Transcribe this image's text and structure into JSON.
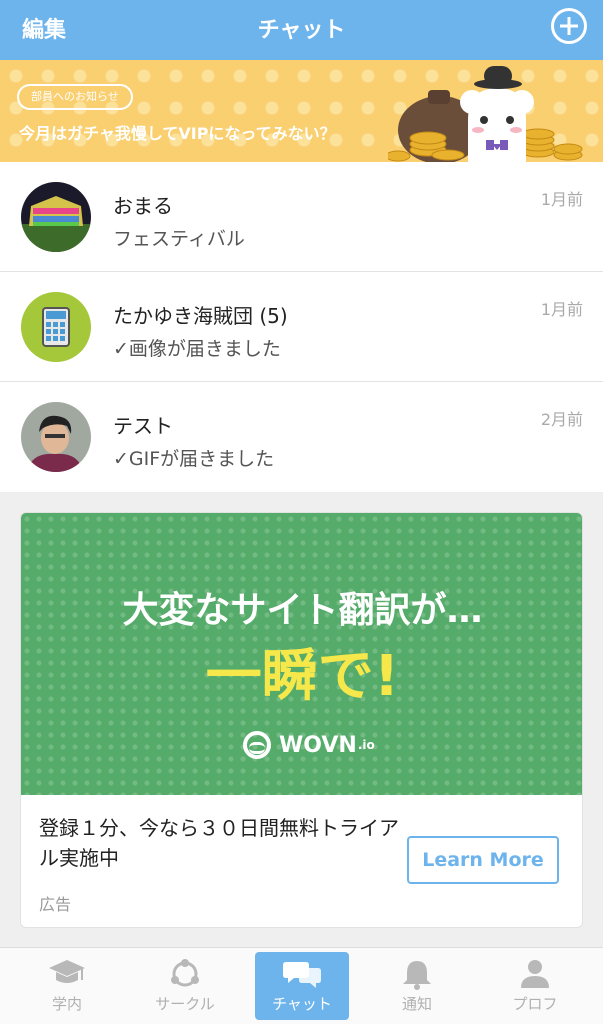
{
  "header": {
    "edit_label": "編集",
    "title": "チャット"
  },
  "banner": {
    "tag": "部員へのお知らせ",
    "message": "今月はガチャ我慢してVIPになってみない？"
  },
  "chats": [
    {
      "name": "おまる",
      "preview": "フェスティバル",
      "time": "1月前"
    },
    {
      "name": "たかゆき海賊団 (5)",
      "preview": "✓画像が届きました",
      "time": "1月前"
    },
    {
      "name": "テスト",
      "preview": "✓GIFが届きました",
      "time": "2月前"
    }
  ],
  "ad": {
    "headline": "大変なサイト翻訳が…",
    "headline_emph": "一瞬で!",
    "logo": "WOVN",
    "logo_suffix": ".io",
    "description": "登録１分、今なら３０日間無料トライアル実施中",
    "cta": "Learn More",
    "label": "広告"
  },
  "tabs": [
    {
      "label": "学内",
      "icon": "graduation-cap-icon"
    },
    {
      "label": "サークル",
      "icon": "circle-network-icon"
    },
    {
      "label": "チャット",
      "icon": "chat-bubbles-icon"
    },
    {
      "label": "通知",
      "icon": "bell-icon"
    },
    {
      "label": "プロフ",
      "icon": "person-icon"
    }
  ],
  "colors": {
    "accent": "#6eb4ec",
    "banner": "#f9cf6f",
    "ad_green": "#55ab69",
    "ad_yellow": "#f6e84a"
  }
}
